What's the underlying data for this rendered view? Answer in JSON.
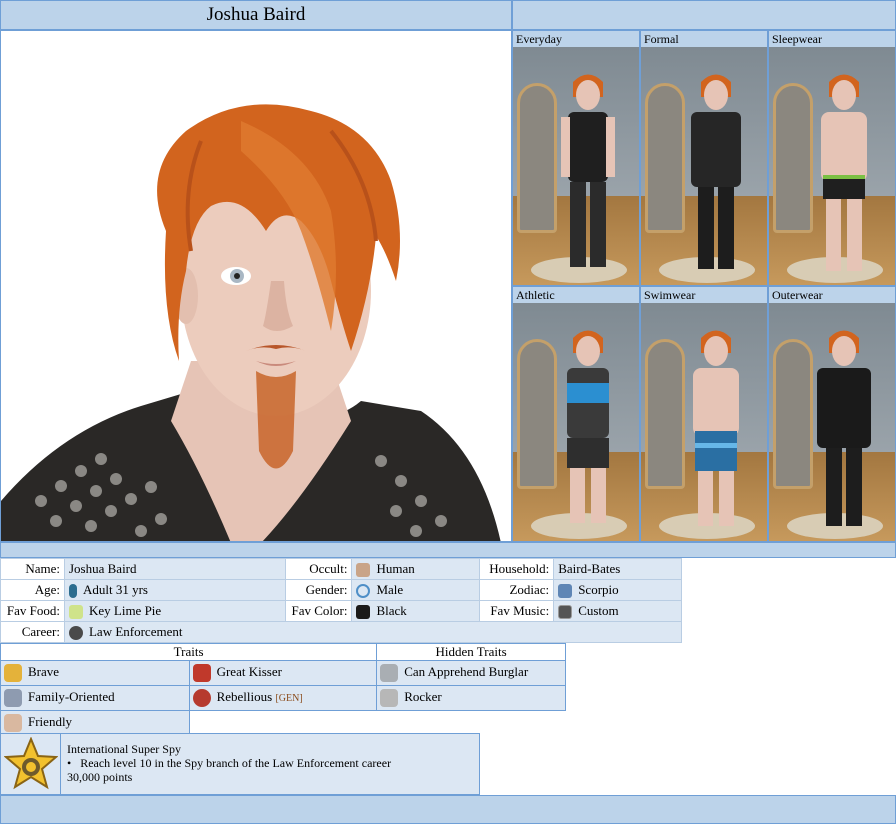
{
  "sim_name": "Joshua Baird",
  "outfits": [
    {
      "label": "Everyday"
    },
    {
      "label": "Formal"
    },
    {
      "label": "Sleepwear"
    },
    {
      "label": "Athletic"
    },
    {
      "label": "Swimwear"
    },
    {
      "label": "Outerwear"
    }
  ],
  "info": {
    "name_label": "Name:",
    "name_value": "Joshua Baird",
    "occult_label": "Occult:",
    "occult_value": "Human",
    "household_label": "Household:",
    "household_value": "Baird-Bates",
    "age_label": "Age:",
    "age_value": "Adult 31 yrs",
    "gender_label": "Gender:",
    "gender_value": "Male",
    "zodiac_label": "Zodiac:",
    "zodiac_value": "Scorpio",
    "food_label": "Fav Food:",
    "food_value": "Key Lime Pie",
    "color_label": "Fav Color:",
    "color_value": "Black",
    "music_label": "Fav Music:",
    "music_value": "Custom",
    "career_label": "Career:",
    "career_value": "Law Enforcement"
  },
  "traits_header": "Traits",
  "hidden_traits_header": "Hidden Traits",
  "traits": [
    {
      "label": "Brave",
      "icon": "medal-icon"
    },
    {
      "label": "Great Kisser",
      "icon": "lips-icon"
    },
    {
      "label": "Family-Oriented",
      "icon": "family-icon"
    },
    {
      "label": "Rebellious",
      "icon": "rebel-icon",
      "tag": "[GEN]"
    },
    {
      "label": "Friendly",
      "icon": "handshake-icon"
    }
  ],
  "hidden_traits": [
    {
      "label": "Can Apprehend Burglar",
      "icon": "handcuffs-icon"
    },
    {
      "label": "Rocker",
      "icon": "guitar-icon"
    }
  ],
  "wish": {
    "title": "International Super Spy",
    "bullet": "•",
    "description": "Reach level 10 in the Spy branch of the Law Enforcement career",
    "points": "30,000 points"
  },
  "colors": {
    "bar_blue": "#bcd3ea",
    "border_blue": "#6f9fd6",
    "cell_blue": "#dce7f3",
    "hair": "#d2641e"
  }
}
